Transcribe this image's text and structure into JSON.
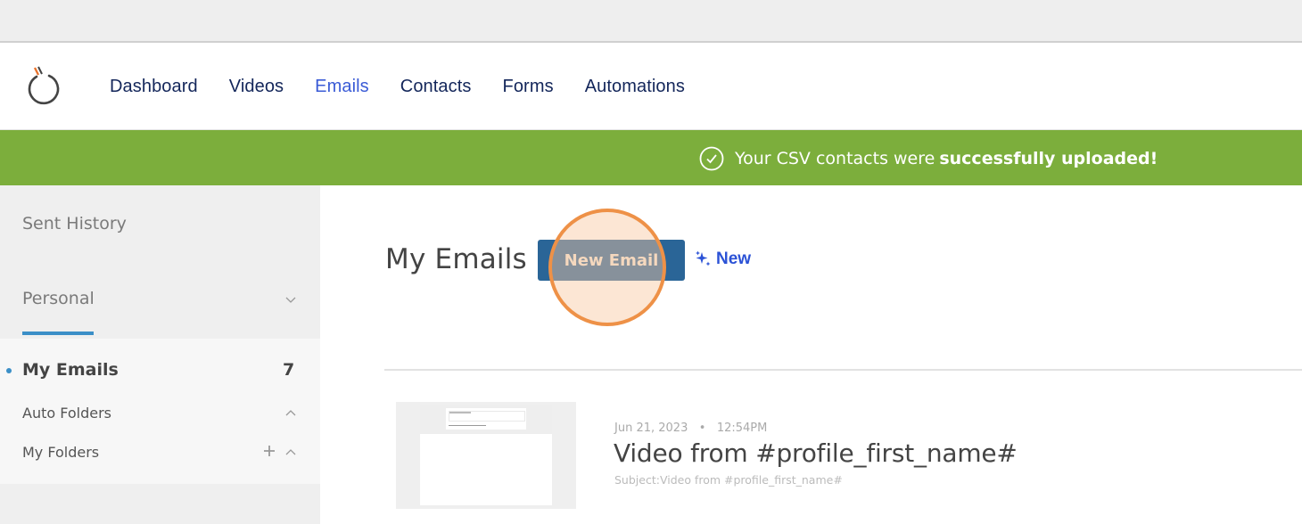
{
  "nav": {
    "logo_icon": "power-ring-logo",
    "items": [
      {
        "label": "Dashboard",
        "active": false
      },
      {
        "label": "Videos",
        "active": false
      },
      {
        "label": "Emails",
        "active": true
      },
      {
        "label": "Contacts",
        "active": false
      },
      {
        "label": "Forms",
        "active": false
      },
      {
        "label": "Automations",
        "active": false
      }
    ],
    "colors": {
      "text": "#13265a",
      "active": "#3a5bd6"
    }
  },
  "banner": {
    "icon": "check-circle-icon",
    "text": "Your CSV contacts were",
    "bold_text": "successfully uploaded!",
    "color": "#7cae3c"
  },
  "sidebar": {
    "sent_history": "Sent History",
    "section": "Personal",
    "accent": "#3b8fc7",
    "items": [
      {
        "label": "My Emails",
        "count": "7",
        "active": true
      },
      {
        "label": "Auto Folders"
      },
      {
        "label": "My Folders"
      }
    ]
  },
  "main": {
    "title": "My Emails",
    "new_email_button": "New Email",
    "new_ai_link": "New",
    "button_color": "#2a6597",
    "emails": [
      {
        "date": "Jun 21, 2023",
        "time": "12:54PM",
        "title": "Video from #profile_first_name#",
        "subject": "Subject:Video from #profile_first_name#"
      }
    ]
  }
}
